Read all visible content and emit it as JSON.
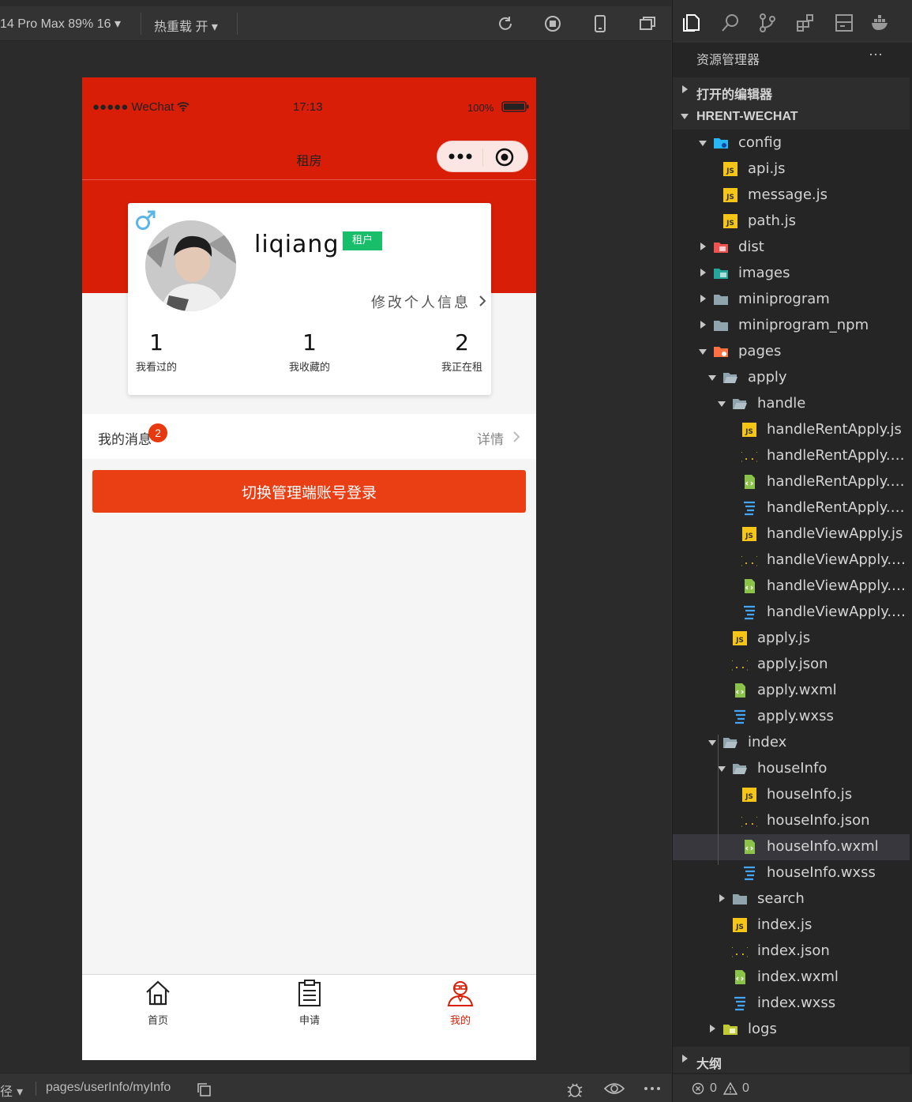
{
  "toolbar": {
    "device_label": "14 Pro Max 89% 16 ▾",
    "hotreload_label": "热重载 开 ▾"
  },
  "phone": {
    "status": {
      "carrier": "●●●●● WeChat",
      "time": "17:13",
      "battery": "100%"
    },
    "nav_title": "租房",
    "profile": {
      "name": "liqiang",
      "badge": "租户",
      "edit_link": "修改个人信息",
      "stats": [
        {
          "value": "1",
          "label": "我看过的"
        },
        {
          "value": "1",
          "label": "我收藏的"
        },
        {
          "value": "2",
          "label": "我正在租"
        }
      ]
    },
    "messages": {
      "label": "我的消息",
      "count": "2",
      "detail": "详情"
    },
    "switch_button": "切换管理端账号登录",
    "tabs": [
      {
        "label": "首页",
        "icon": "home-icon"
      },
      {
        "label": "申请",
        "icon": "clipboard-icon"
      },
      {
        "label": "我的",
        "icon": "user-icon"
      }
    ],
    "colors": {
      "primary": "#d81e06",
      "button": "#ea3f15",
      "badge": "#19be6b",
      "active_tab": "#d81e06"
    }
  },
  "bottombar": {
    "path_prefix": "径 ▾",
    "path": "pages/userInfo/myInfo",
    "errors": "0",
    "warnings": "0"
  },
  "explorer": {
    "title": "资源管理器",
    "more": "···",
    "open_editors": "打开的编辑器",
    "project": "HRENT-WECHAT",
    "outline": "大纲",
    "tree": [
      {
        "name": "config",
        "type": "folder-config",
        "depth": 0,
        "open": true
      },
      {
        "name": "api.js",
        "type": "js",
        "depth": 1
      },
      {
        "name": "message.js",
        "type": "js",
        "depth": 1
      },
      {
        "name": "path.js",
        "type": "js",
        "depth": 1
      },
      {
        "name": "dist",
        "type": "folder-dist",
        "depth": 0,
        "open": false
      },
      {
        "name": "images",
        "type": "folder-images",
        "depth": 0,
        "open": false
      },
      {
        "name": "miniprogram",
        "type": "folder",
        "depth": 0,
        "open": false
      },
      {
        "name": "miniprogram_npm",
        "type": "folder",
        "depth": 0,
        "open": false
      },
      {
        "name": "pages",
        "type": "folder-pages",
        "depth": 0,
        "open": true
      },
      {
        "name": "apply",
        "type": "folder-open",
        "depth": 1,
        "open": true
      },
      {
        "name": "handle",
        "type": "folder-open",
        "depth": 2,
        "open": true
      },
      {
        "name": "handleRentApply.js",
        "type": "js",
        "depth": 3
      },
      {
        "name": "handleRentApply.json",
        "type": "json",
        "depth": 3
      },
      {
        "name": "handleRentApply.wxml",
        "type": "wxml",
        "depth": 3
      },
      {
        "name": "handleRentApply.wxss",
        "type": "wxss",
        "depth": 3
      },
      {
        "name": "handleViewApply.js",
        "type": "js",
        "depth": 3
      },
      {
        "name": "handleViewApply.json",
        "type": "json",
        "depth": 3
      },
      {
        "name": "handleViewApply.wxml",
        "type": "wxml",
        "depth": 3
      },
      {
        "name": "handleViewApply.wxss",
        "type": "wxss",
        "depth": 3
      },
      {
        "name": "apply.js",
        "type": "js",
        "depth": 2
      },
      {
        "name": "apply.json",
        "type": "json",
        "depth": 2
      },
      {
        "name": "apply.wxml",
        "type": "wxml",
        "depth": 2
      },
      {
        "name": "apply.wxss",
        "type": "wxss",
        "depth": 2
      },
      {
        "name": "index",
        "type": "folder-open",
        "depth": 1,
        "open": true
      },
      {
        "name": "houseInfo",
        "type": "folder-open",
        "depth": 2,
        "open": true
      },
      {
        "name": "houseInfo.js",
        "type": "js",
        "depth": 3
      },
      {
        "name": "houseInfo.json",
        "type": "json",
        "depth": 3
      },
      {
        "name": "houseInfo.wxml",
        "type": "wxml",
        "depth": 3,
        "selected": true
      },
      {
        "name": "houseInfo.wxss",
        "type": "wxss",
        "depth": 3
      },
      {
        "name": "search",
        "type": "folder",
        "depth": 2,
        "open": false
      },
      {
        "name": "index.js",
        "type": "js",
        "depth": 2
      },
      {
        "name": "index.json",
        "type": "json",
        "depth": 2
      },
      {
        "name": "index.wxml",
        "type": "wxml",
        "depth": 2
      },
      {
        "name": "index.wxss",
        "type": "wxss",
        "depth": 2
      },
      {
        "name": "logs",
        "type": "folder-logs",
        "depth": 1,
        "open": false
      }
    ]
  }
}
